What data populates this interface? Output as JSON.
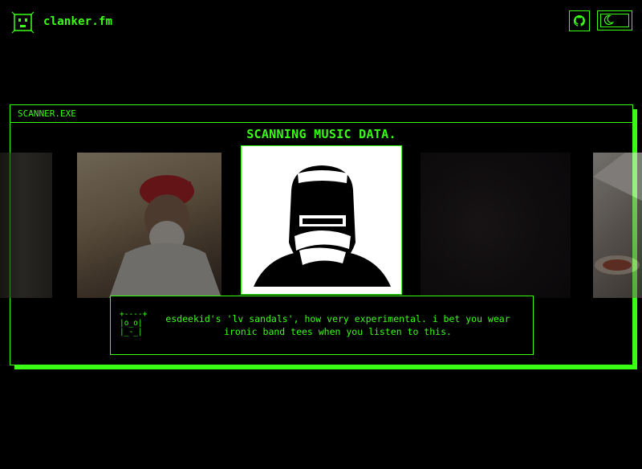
{
  "header": {
    "brand": "clanker.fm",
    "logo_icon": "robot-face-icon",
    "github_icon": "github-icon",
    "theme_icon": "moon-icon"
  },
  "scanner": {
    "window_title": "SCANNER.EXE",
    "heading": "SCANNING MUSIC DATA."
  },
  "dialog": {
    "avatar_art": "+----+\n|o_o|\n|_-_|",
    "message": "esdeekid's 'lv sandals', how very experimental. i bet you wear ironic band tees when you listen to this."
  },
  "colors": {
    "accent": "#39ff14",
    "background": "#000000"
  }
}
